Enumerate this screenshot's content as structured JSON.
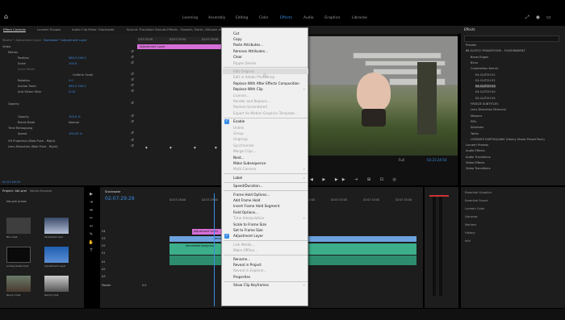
{
  "topbar": {
    "workspaces": [
      "Learning",
      "Assembly",
      "Editing",
      "Color",
      "Effects",
      "Audio",
      "Graphics",
      "Libraries"
    ],
    "active_workspace": "Effects"
  },
  "panel_tabs": {
    "effect_controls": "Effect Controls",
    "lumetri_scopes": "Lumetri Scopes",
    "audio_mixer": "Audio Clip Mixer: Slackwate",
    "source": "Source: Transition Sounds Effects - Swoosh, Swish, Whoosh.mp3",
    "effects": "Effects"
  },
  "effect_controls": {
    "source_label": "Master * Adjustment Layer",
    "sequence_label": "Slackwate * Adjustment Layer",
    "ruler": [
      "2:07:29:29",
      "02:07:29:30",
      "02:07:29:38"
    ],
    "clip_bar": "Adjustment Layer",
    "section_video": "Video",
    "properties": [
      {
        "name": "Motion",
        "value": ""
      },
      {
        "name": "Position",
        "value": "960.0   540.0"
      },
      {
        "name": "Scale",
        "value": "100.0"
      },
      {
        "name": "Scale Width",
        "value": ""
      },
      {
        "name": "",
        "value": "Uniform Scale"
      },
      {
        "name": "Rotation",
        "value": "0.0"
      },
      {
        "name": "Anchor Point",
        "value": "960.0   540.0"
      },
      {
        "name": "Anti-flicker Filter",
        "value": "0.00"
      },
      {
        "name": "Opacity",
        "value": ""
      },
      {
        "name": "Opacity",
        "value": "100.0 %"
      },
      {
        "name": "Blend Mode",
        "value": "Normal"
      },
      {
        "name": "Time Remapping",
        "value": ""
      },
      {
        "name": "Speed",
        "value": "100.00 %"
      },
      {
        "name": "VR Projection (Blob Push - Right)",
        "value": ""
      },
      {
        "name": "Lens Distortion (Blob Push - Right)",
        "value": ""
      }
    ],
    "timecode": "02:07:29:29"
  },
  "program_monitor": {
    "fit": "Full",
    "timecode": "03:21:24:54"
  },
  "effects_panel": {
    "title": "Effects",
    "items": [
      {
        "label": "Presets",
        "level": 0,
        "selected": false
      },
      {
        "label": "88 GLITCH TRANSITIONS - FILMORAMENT",
        "level": 0,
        "selected": false
      },
      {
        "label": "Bevel Edges",
        "level": 1,
        "selected": false
      },
      {
        "label": "Blurs",
        "level": 1,
        "selected": false
      },
      {
        "label": "Colorization Kernel",
        "level": 1,
        "selected": false
      },
      {
        "label": "EA GLITCH 01",
        "level": 2,
        "selected": false
      },
      {
        "label": "EA GLITCH 02",
        "level": 2,
        "selected": false
      },
      {
        "label": "EA GLITCH 03",
        "level": 2,
        "selected": true
      },
      {
        "label": "EA GLITCH 04",
        "level": 2,
        "selected": false
      },
      {
        "label": "EA GLITCH 05",
        "level": 2,
        "selected": false
      },
      {
        "label": "FREEZE SUBTITLES",
        "level": 1,
        "selected": false
      },
      {
        "label": "Lens Distortion Removal",
        "level": 1,
        "selected": false
      },
      {
        "label": "Mosaics",
        "level": 1,
        "selected": false
      },
      {
        "label": "PiPs",
        "level": 1,
        "selected": false
      },
      {
        "label": "Solarizes",
        "level": 1,
        "selected": false
      },
      {
        "label": "Twirls",
        "level": 1,
        "selected": false
      },
      {
        "label": "ULTIMATE EARTHQUAKE (Heavy Shake Preset Pack)",
        "level": 1,
        "selected": false
      },
      {
        "label": "Lumetri Presets",
        "level": 0,
        "selected": false
      },
      {
        "label": "Audio Effects",
        "level": 0,
        "selected": false
      },
      {
        "label": "Audio Transitions",
        "level": 0,
        "selected": false
      },
      {
        "label": "Video Effects",
        "level": 0,
        "selected": false
      },
      {
        "label": "Video Transitions",
        "level": 0,
        "selected": false
      }
    ]
  },
  "lower_right_panels": [
    "Essential Graphics",
    "Essential Sound",
    "Lumetri Color",
    "Libraries",
    "Markers",
    "History",
    "Info"
  ],
  "project_panel": {
    "tabs": [
      "Project: tdk.prel",
      "Media Browser"
    ],
    "filter": "tdk.prel prores",
    "items": [
      {
        "label": "Blur.mp4"
      },
      {
        "label": "Illustrated.mp4"
      },
      {
        "label": "Wallpaper.mp4"
      },
      {
        "label": "ending beats.mp4"
      },
      {
        "label": "Adjustment Layer"
      },
      {
        "label": "Rec(1).mp4"
      },
      {
        "label": "Rec(2).mp4"
      },
      {
        "label": "Rec(3).mp4"
      }
    ]
  },
  "timeline": {
    "sequence_tab": "Slackwate",
    "timecode": "02:07:29:29",
    "ruler": [
      "02:07:28:00",
      "02:07:29:00",
      "02:07:30:00",
      "02:07:31:00",
      "02:07:32:00",
      "02:07:33:00",
      "02:07:34:00",
      "02:07:35:00"
    ],
    "tracks": [
      "V4",
      "V3",
      "V2",
      "V1",
      "A1",
      "A2",
      "A3",
      "Master"
    ],
    "master_value": "0.0",
    "clips": {
      "adjustment": "Adjustment Layer",
      "video": "Immediate body.mov [V]",
      "audio": "Immediate body.mov"
    }
  },
  "context_menu": {
    "items": [
      {
        "label": "Cut",
        "disabled": false
      },
      {
        "label": "Copy",
        "disabled": false
      },
      {
        "label": "Paste Attributes...",
        "disabled": false
      },
      {
        "label": "Remove Attributes...",
        "disabled": false
      },
      {
        "label": "Clear",
        "disabled": false
      },
      {
        "label": "Ripple Delete",
        "disabled": true
      },
      {
        "sep": true
      },
      {
        "label": "Edit Original",
        "disabled": true,
        "hover": true
      },
      {
        "label": "Edit in Adobe Photoshop",
        "disabled": true
      },
      {
        "label": "Replace With After Effects Composition",
        "disabled": false
      },
      {
        "label": "Replace With Clip",
        "disabled": false,
        "submenu": true
      },
      {
        "label": "License...",
        "disabled": true
      },
      {
        "label": "Render and Replace...",
        "disabled": true
      },
      {
        "label": "Restore Unrendered",
        "disabled": true
      },
      {
        "label": "Export As Motion Graphics Template...",
        "disabled": true
      },
      {
        "sep": true
      },
      {
        "label": "Enable",
        "disabled": false,
        "checked": true
      },
      {
        "label": "Unlink",
        "disabled": true
      },
      {
        "label": "Group",
        "disabled": true
      },
      {
        "label": "Ungroup",
        "disabled": true
      },
      {
        "label": "Synchronize",
        "disabled": true
      },
      {
        "label": "Merge Clips...",
        "disabled": true
      },
      {
        "label": "Nest...",
        "disabled": false
      },
      {
        "label": "Make Subsequence",
        "disabled": false
      },
      {
        "label": "Multi-Camera",
        "disabled": true,
        "submenu": true
      },
      {
        "sep": true
      },
      {
        "label": "Label",
        "disabled": false,
        "submenu": true
      },
      {
        "sep": true
      },
      {
        "label": "Speed/Duration...",
        "disabled": false
      },
      {
        "sep": true
      },
      {
        "label": "Frame Hold Options...",
        "disabled": false
      },
      {
        "label": "Add Frame Hold",
        "disabled": false
      },
      {
        "label": "Insert Frame Hold Segment",
        "disabled": false
      },
      {
        "label": "Field Options...",
        "disabled": false
      },
      {
        "label": "Time Interpolation",
        "disabled": true,
        "submenu": true
      },
      {
        "label": "Scale to Frame Size",
        "disabled": false
      },
      {
        "label": "Set to Frame Size",
        "disabled": false
      },
      {
        "label": "Adjustment Layer",
        "disabled": false,
        "checked": true
      },
      {
        "sep": true
      },
      {
        "label": "Link Media...",
        "disabled": true
      },
      {
        "label": "Make Offline...",
        "disabled": true
      },
      {
        "sep": true
      },
      {
        "label": "Rename...",
        "disabled": false
      },
      {
        "label": "Reveal in Project",
        "disabled": false
      },
      {
        "label": "Reveal in Explorer...",
        "disabled": true
      },
      {
        "label": "Properties",
        "disabled": false
      },
      {
        "sep": true
      },
      {
        "label": "Show Clip Keyframes",
        "disabled": false,
        "submenu": true
      }
    ]
  },
  "colors": {
    "accent": "#3a8ee6",
    "adjustment_clip": "#d66fd8",
    "video_clip": "#6ba2de",
    "audio_clip": "#3cae8a"
  }
}
